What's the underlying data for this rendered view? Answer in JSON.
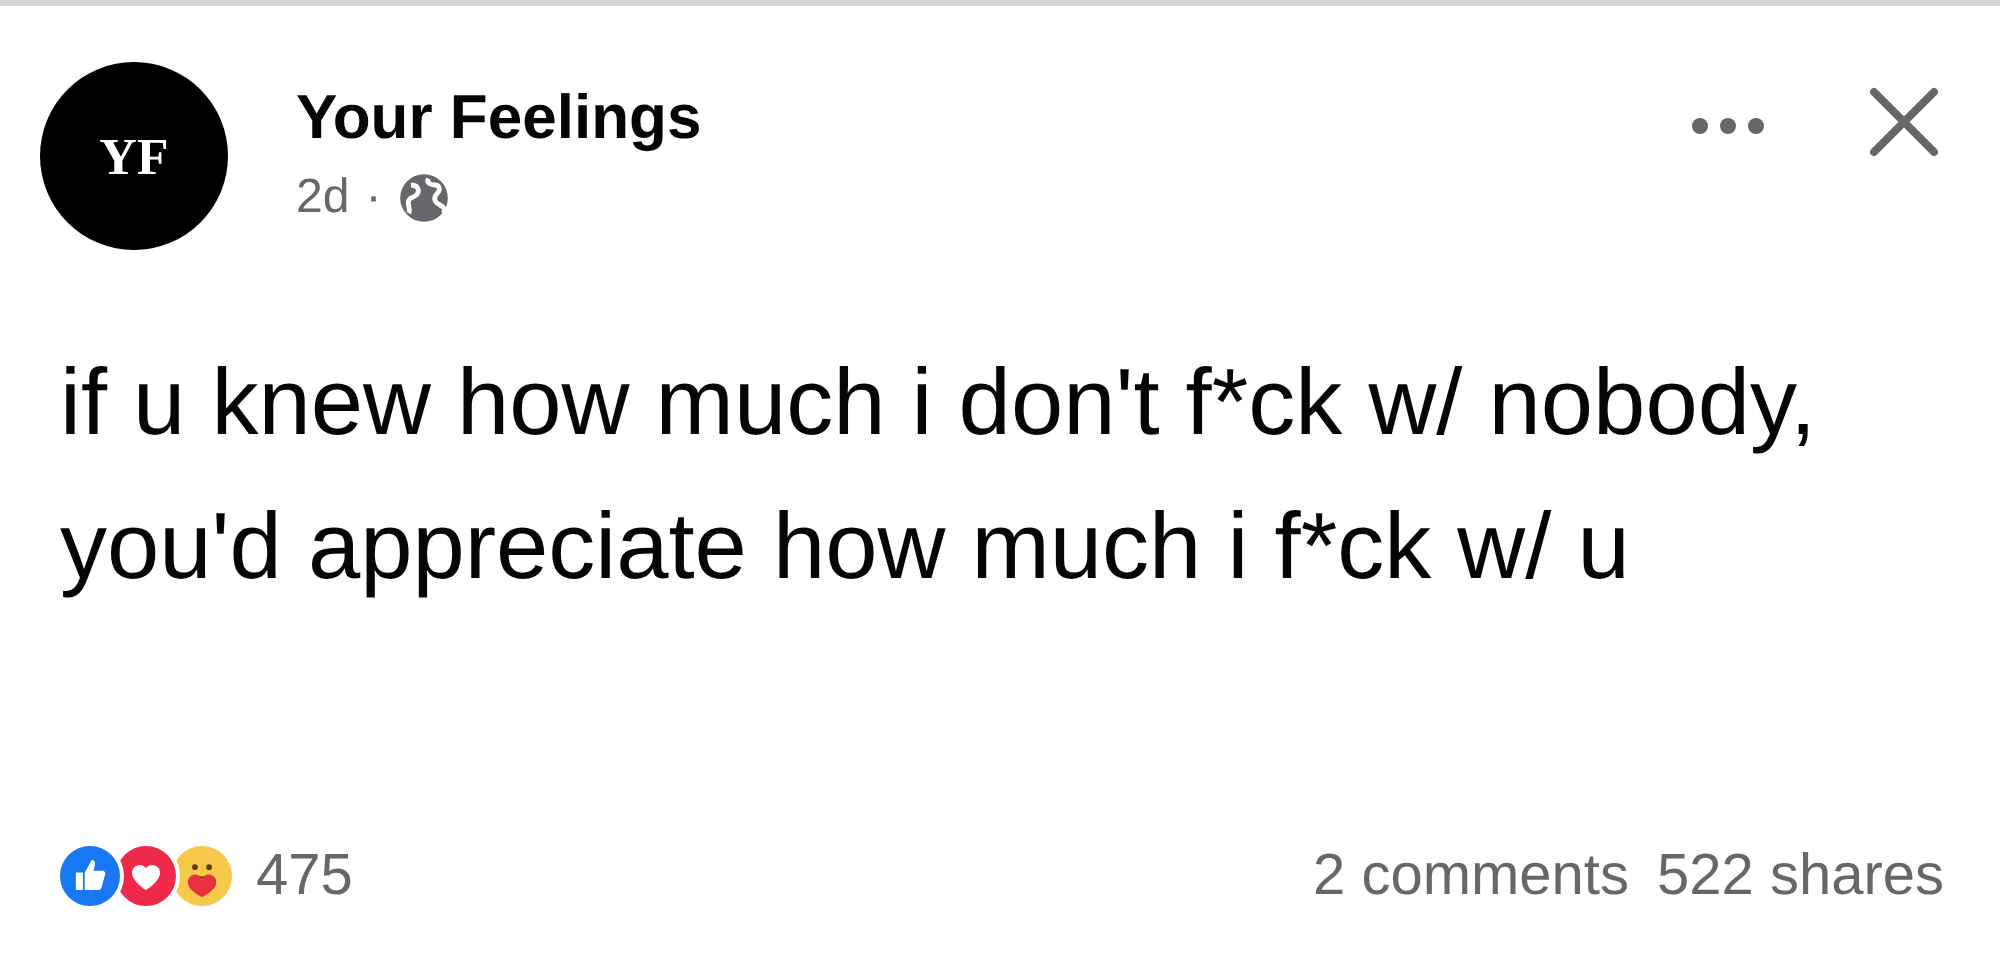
{
  "post": {
    "avatar_initials": "YF",
    "author": "Your Feelings",
    "time": "2d",
    "separator": "·",
    "text": "if u knew how much i don't f*ck w/ nobody, you'd appreciate how much i f*ck w/ u",
    "reactions": [
      {
        "kind": "like"
      },
      {
        "kind": "love"
      },
      {
        "kind": "care"
      }
    ],
    "reaction_count": "475",
    "comments": "2 comments",
    "shares": "522 shares"
  }
}
